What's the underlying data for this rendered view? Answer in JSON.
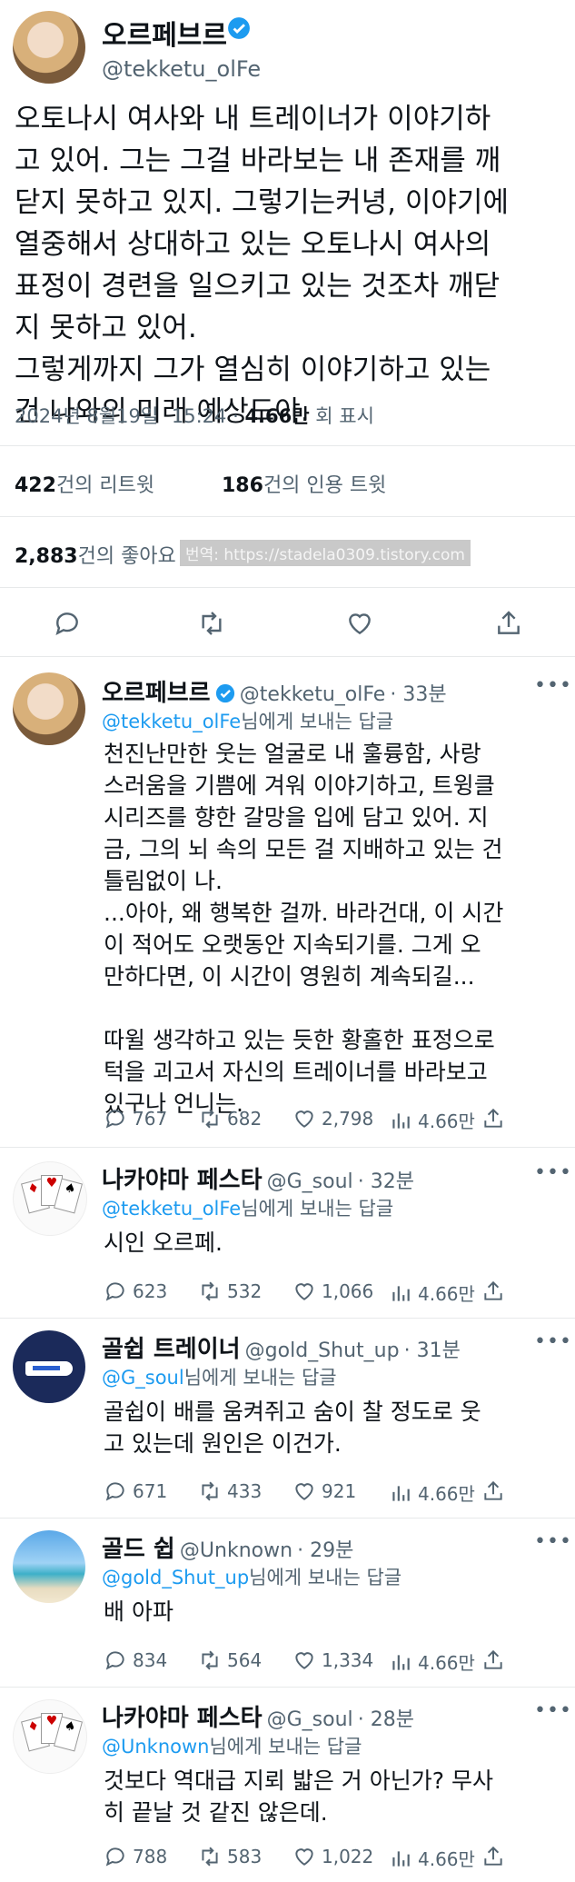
{
  "main": {
    "author_name": "오르페브르",
    "handle": "@tekketu_olFe",
    "body": "오토나시 여사와 내 트레이너가 이야기하\n고 있어. 그는 그걸 바라보는 내 존재를 깨\n닫지 못하고 있지. 그렇기는커녕, 이야기에\n열중해서 상대하고 있는 오토나시 여사의\n표정이 경련을 일으키고 있는 것조차 깨닫\n지 못하고 있어.\n그렇게까지 그가 열심히 이야기하고 있는\n건 나와의 미래 예상도야.",
    "date": "2024년 8월19일",
    "time": "15:24",
    "views_count": "4.66만",
    "views_label": "회 표시",
    "retweets_count": "422",
    "retweets_label": "건의 리트윗",
    "quotes_count": "186",
    "quotes_label": "건의 인용 트윗",
    "likes_count": "2,883",
    "likes_label": "건의 좋아요",
    "watermark": "번역: https://stadela0309.tistory.com"
  },
  "replies": [
    {
      "name": "오르페브르",
      "handle": "@tekketu_olFe",
      "time": "· 33분",
      "reply_to_handle": "@tekketu_olFe",
      "reply_to_suffix": "님에게 보내는 답글",
      "body": "천진난만한 웃는 얼굴로 내 훌륭함, 사랑\n스러움을 기쁨에 겨워 이야기하고, 트윙클\n시리즈를 향한 갈망을 입에 담고 있어. 지\n금, 그의 뇌 속의 모든 걸 지배하고 있는 건\n틀림없이 나.\n...아아, 왜 행복한 걸까. 바라건대, 이 시간\n이 적어도 오랫동안 지속되기를. 그게 오\n만하다면, 이 시간이 영원히 계속되길...\n\n따윌 생각하고 있는 듯한 황홀한 표정으로\n턱을 괴고서 자신의 트레이너를 바라보고\n있구나 언니는.",
      "replies": "767",
      "retweets": "682",
      "likes": "2,798",
      "views": "4.66만"
    },
    {
      "name": "나카야마 페스타",
      "handle": "@G_soul",
      "time": "· 32분",
      "reply_to_handle": "@tekketu_olFe",
      "reply_to_suffix": "님에게 보내는 답글",
      "body": "시인 오르페.",
      "replies": "623",
      "retweets": "532",
      "likes": "1,066",
      "views": "4.66만"
    },
    {
      "name": "골쉽 트레이너",
      "handle": "@gold_Shut_up",
      "time": "· 31분",
      "reply_to_handle": "@G_soul",
      "reply_to_suffix": "님에게 보내는 답글",
      "body": "골쉽이 배를 움켜쥐고 숨이 찰 정도로 웃\n고 있는데 원인은 이건가.",
      "replies": "671",
      "retweets": "433",
      "likes": "921",
      "views": "4.66만"
    },
    {
      "name": "골드 쉽",
      "handle": "@Unknown",
      "time": "· 29분",
      "reply_to_handle": "@gold_Shut_up",
      "reply_to_suffix": "님에게 보내는 답글",
      "body": "배 아파",
      "replies": "834",
      "retweets": "564",
      "likes": "1,334",
      "views": "4.66만"
    },
    {
      "name": "나카야마 페스타",
      "handle": "@G_soul",
      "time": "· 28분",
      "reply_to_handle": "@Unknown",
      "reply_to_suffix": "님에게 보내는 답글",
      "body": "것보다 역대급 지뢰 밟은 거 아닌가? 무사\n히 끝날 것 같진 않은데.",
      "replies": "788",
      "retweets": "583",
      "likes": "1,022",
      "views": "4.66만"
    }
  ],
  "colors": {
    "link": "#1d9bf0",
    "muted": "#536471",
    "verified": "#1d9bf0",
    "divider": "#e7e9ea"
  },
  "icons": [
    "verified-badge-icon",
    "reply-icon",
    "retweet-icon",
    "like-icon",
    "share-icon",
    "views-icon",
    "more-icon"
  ]
}
